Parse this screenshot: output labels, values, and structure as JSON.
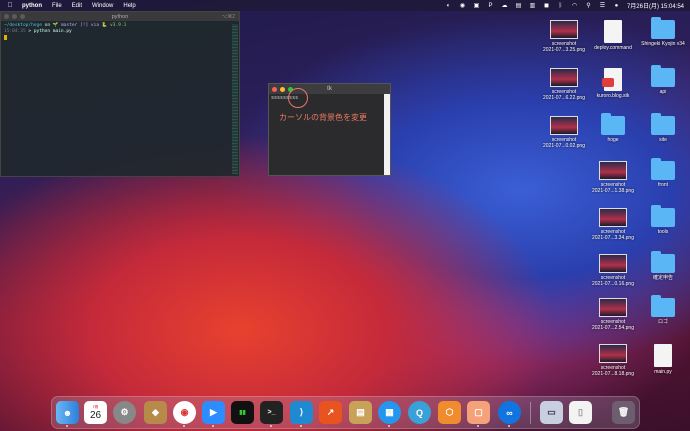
{
  "menubar": {
    "app_name": "python",
    "items": [
      "File",
      "Edit",
      "Window",
      "Help"
    ],
    "clock": "7月26日(月)  15:04:54"
  },
  "terminal": {
    "title": "python",
    "shortcut": "⌥⌘2",
    "line1_path": "~/desktop/hoge",
    "line1_on": " on ",
    "line1_branch": "🌱 master [!] via ",
    "line1_py": "🐍 v3.9.1",
    "line2_time": "15:04:35",
    "line2_cmd": " > python main.py"
  },
  "tk_window": {
    "title": "tk",
    "entry_text": "sssssssss",
    "annotation": "カーソルの背景色を変更"
  },
  "desktop_icons": [
    {
      "label": "screenshot\n2021-07...3.25.png",
      "kind": "thumb"
    },
    {
      "label": "deploy.command",
      "kind": "file"
    },
    {
      "label": "Shingeki Kyojin v34",
      "kind": "folder"
    },
    {
      "label": "screenshot\n2021-07...6.22.png",
      "kind": "thumb"
    },
    {
      "label": "kuroro.blog.stk",
      "kind": "stk"
    },
    {
      "label": "api",
      "kind": "folder"
    },
    {
      "label": "screenshot\n2021-07...0.02.png",
      "kind": "thumb"
    },
    {
      "label": "hoge",
      "kind": "folder"
    },
    {
      "label": "site",
      "kind": "folder"
    },
    {
      "label": "screenshot\n2021-07...1.38.png",
      "kind": "thumb"
    },
    {
      "label": "front",
      "kind": "folder"
    },
    {
      "label": "screenshot\n2021-07...3.34.png",
      "kind": "thumb"
    },
    {
      "label": "tools",
      "kind": "folder"
    },
    {
      "label": "screenshot\n2021-07...0.16.png",
      "kind": "thumb"
    },
    {
      "label": "確定申告",
      "kind": "folder"
    },
    {
      "label": "screenshot\n2021-07...2.54.png",
      "kind": "thumb"
    },
    {
      "label": "ロゴ",
      "kind": "folder"
    },
    {
      "label": "screenshot\n2021-07...8.18.png",
      "kind": "thumb"
    },
    {
      "label": "main.py",
      "kind": "file"
    }
  ],
  "dock": {
    "calendar_month": "7月",
    "calendar_day": "26"
  }
}
